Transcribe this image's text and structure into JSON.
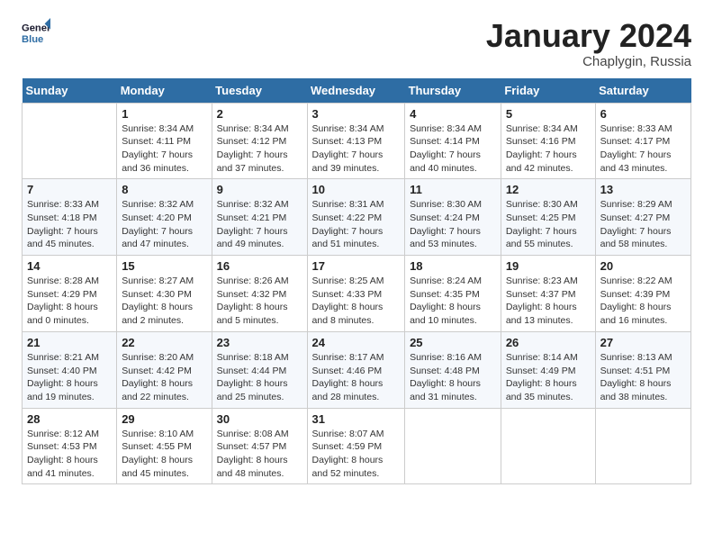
{
  "header": {
    "logo_line1": "General",
    "logo_line2": "Blue",
    "month": "January 2024",
    "location": "Chaplygin, Russia"
  },
  "days_of_week": [
    "Sunday",
    "Monday",
    "Tuesday",
    "Wednesday",
    "Thursday",
    "Friday",
    "Saturday"
  ],
  "weeks": [
    [
      {
        "day": "",
        "sunrise": "",
        "sunset": "",
        "daylight": ""
      },
      {
        "day": "1",
        "sunrise": "Sunrise: 8:34 AM",
        "sunset": "Sunset: 4:11 PM",
        "daylight": "Daylight: 7 hours and 36 minutes."
      },
      {
        "day": "2",
        "sunrise": "Sunrise: 8:34 AM",
        "sunset": "Sunset: 4:12 PM",
        "daylight": "Daylight: 7 hours and 37 minutes."
      },
      {
        "day": "3",
        "sunrise": "Sunrise: 8:34 AM",
        "sunset": "Sunset: 4:13 PM",
        "daylight": "Daylight: 7 hours and 39 minutes."
      },
      {
        "day": "4",
        "sunrise": "Sunrise: 8:34 AM",
        "sunset": "Sunset: 4:14 PM",
        "daylight": "Daylight: 7 hours and 40 minutes."
      },
      {
        "day": "5",
        "sunrise": "Sunrise: 8:34 AM",
        "sunset": "Sunset: 4:16 PM",
        "daylight": "Daylight: 7 hours and 42 minutes."
      },
      {
        "day": "6",
        "sunrise": "Sunrise: 8:33 AM",
        "sunset": "Sunset: 4:17 PM",
        "daylight": "Daylight: 7 hours and 43 minutes."
      }
    ],
    [
      {
        "day": "7",
        "sunrise": "Sunrise: 8:33 AM",
        "sunset": "Sunset: 4:18 PM",
        "daylight": "Daylight: 7 hours and 45 minutes."
      },
      {
        "day": "8",
        "sunrise": "Sunrise: 8:32 AM",
        "sunset": "Sunset: 4:20 PM",
        "daylight": "Daylight: 7 hours and 47 minutes."
      },
      {
        "day": "9",
        "sunrise": "Sunrise: 8:32 AM",
        "sunset": "Sunset: 4:21 PM",
        "daylight": "Daylight: 7 hours and 49 minutes."
      },
      {
        "day": "10",
        "sunrise": "Sunrise: 8:31 AM",
        "sunset": "Sunset: 4:22 PM",
        "daylight": "Daylight: 7 hours and 51 minutes."
      },
      {
        "day": "11",
        "sunrise": "Sunrise: 8:30 AM",
        "sunset": "Sunset: 4:24 PM",
        "daylight": "Daylight: 7 hours and 53 minutes."
      },
      {
        "day": "12",
        "sunrise": "Sunrise: 8:30 AM",
        "sunset": "Sunset: 4:25 PM",
        "daylight": "Daylight: 7 hours and 55 minutes."
      },
      {
        "day": "13",
        "sunrise": "Sunrise: 8:29 AM",
        "sunset": "Sunset: 4:27 PM",
        "daylight": "Daylight: 7 hours and 58 minutes."
      }
    ],
    [
      {
        "day": "14",
        "sunrise": "Sunrise: 8:28 AM",
        "sunset": "Sunset: 4:29 PM",
        "daylight": "Daylight: 8 hours and 0 minutes."
      },
      {
        "day": "15",
        "sunrise": "Sunrise: 8:27 AM",
        "sunset": "Sunset: 4:30 PM",
        "daylight": "Daylight: 8 hours and 2 minutes."
      },
      {
        "day": "16",
        "sunrise": "Sunrise: 8:26 AM",
        "sunset": "Sunset: 4:32 PM",
        "daylight": "Daylight: 8 hours and 5 minutes."
      },
      {
        "day": "17",
        "sunrise": "Sunrise: 8:25 AM",
        "sunset": "Sunset: 4:33 PM",
        "daylight": "Daylight: 8 hours and 8 minutes."
      },
      {
        "day": "18",
        "sunrise": "Sunrise: 8:24 AM",
        "sunset": "Sunset: 4:35 PM",
        "daylight": "Daylight: 8 hours and 10 minutes."
      },
      {
        "day": "19",
        "sunrise": "Sunrise: 8:23 AM",
        "sunset": "Sunset: 4:37 PM",
        "daylight": "Daylight: 8 hours and 13 minutes."
      },
      {
        "day": "20",
        "sunrise": "Sunrise: 8:22 AM",
        "sunset": "Sunset: 4:39 PM",
        "daylight": "Daylight: 8 hours and 16 minutes."
      }
    ],
    [
      {
        "day": "21",
        "sunrise": "Sunrise: 8:21 AM",
        "sunset": "Sunset: 4:40 PM",
        "daylight": "Daylight: 8 hours and 19 minutes."
      },
      {
        "day": "22",
        "sunrise": "Sunrise: 8:20 AM",
        "sunset": "Sunset: 4:42 PM",
        "daylight": "Daylight: 8 hours and 22 minutes."
      },
      {
        "day": "23",
        "sunrise": "Sunrise: 8:18 AM",
        "sunset": "Sunset: 4:44 PM",
        "daylight": "Daylight: 8 hours and 25 minutes."
      },
      {
        "day": "24",
        "sunrise": "Sunrise: 8:17 AM",
        "sunset": "Sunset: 4:46 PM",
        "daylight": "Daylight: 8 hours and 28 minutes."
      },
      {
        "day": "25",
        "sunrise": "Sunrise: 8:16 AM",
        "sunset": "Sunset: 4:48 PM",
        "daylight": "Daylight: 8 hours and 31 minutes."
      },
      {
        "day": "26",
        "sunrise": "Sunrise: 8:14 AM",
        "sunset": "Sunset: 4:49 PM",
        "daylight": "Daylight: 8 hours and 35 minutes."
      },
      {
        "day": "27",
        "sunrise": "Sunrise: 8:13 AM",
        "sunset": "Sunset: 4:51 PM",
        "daylight": "Daylight: 8 hours and 38 minutes."
      }
    ],
    [
      {
        "day": "28",
        "sunrise": "Sunrise: 8:12 AM",
        "sunset": "Sunset: 4:53 PM",
        "daylight": "Daylight: 8 hours and 41 minutes."
      },
      {
        "day": "29",
        "sunrise": "Sunrise: 8:10 AM",
        "sunset": "Sunset: 4:55 PM",
        "daylight": "Daylight: 8 hours and 45 minutes."
      },
      {
        "day": "30",
        "sunrise": "Sunrise: 8:08 AM",
        "sunset": "Sunset: 4:57 PM",
        "daylight": "Daylight: 8 hours and 48 minutes."
      },
      {
        "day": "31",
        "sunrise": "Sunrise: 8:07 AM",
        "sunset": "Sunset: 4:59 PM",
        "daylight": "Daylight: 8 hours and 52 minutes."
      },
      {
        "day": "",
        "sunrise": "",
        "sunset": "",
        "daylight": ""
      },
      {
        "day": "",
        "sunrise": "",
        "sunset": "",
        "daylight": ""
      },
      {
        "day": "",
        "sunrise": "",
        "sunset": "",
        "daylight": ""
      }
    ]
  ]
}
